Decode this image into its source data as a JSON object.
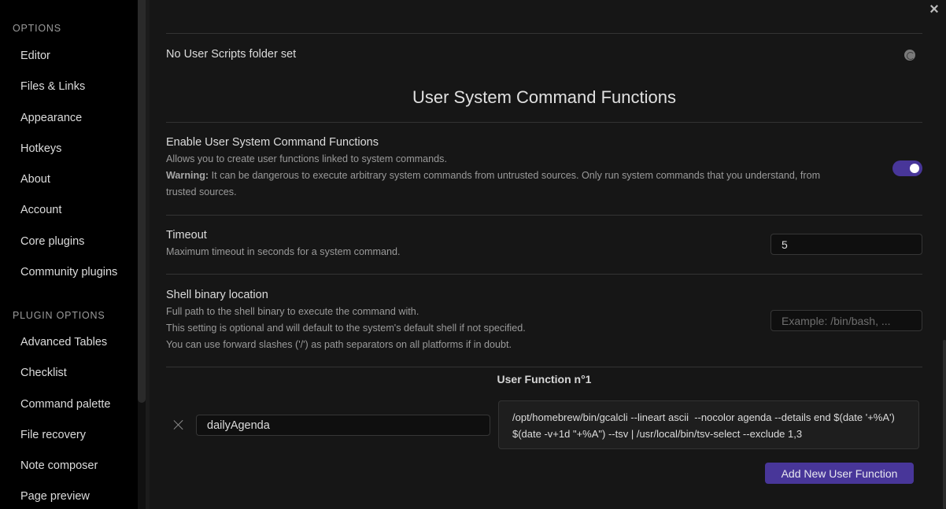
{
  "sidebar": {
    "options_header": "Options",
    "options_items": [
      {
        "label": "Editor"
      },
      {
        "label": "Files & Links"
      },
      {
        "label": "Appearance"
      },
      {
        "label": "Hotkeys"
      },
      {
        "label": "About"
      },
      {
        "label": "Account"
      },
      {
        "label": "Core plugins"
      },
      {
        "label": "Community plugins"
      }
    ],
    "plugin_header": "Plugin Options",
    "plugin_items": [
      {
        "label": "Advanced Tables"
      },
      {
        "label": "Checklist"
      },
      {
        "label": "Command palette"
      },
      {
        "label": "File recovery"
      },
      {
        "label": "Note composer"
      },
      {
        "label": "Page preview"
      }
    ]
  },
  "main": {
    "close_icon": "×",
    "user_scripts": {
      "label": "No User Scripts folder set",
      "icon": "refresh-icon"
    },
    "section_title": "User System Command Functions",
    "enable": {
      "name": "Enable User System Command Functions",
      "desc": "Allows you to create user functions linked to system commands.",
      "warning_label": "Warning:",
      "warning_text": " It can be dangerous to execute arbitrary system commands from untrusted sources. Only run system commands that you understand, from",
      "warning_text2": "trusted sources.",
      "enabled": true
    },
    "timeout": {
      "name": "Timeout",
      "desc": "Maximum timeout in seconds for a system command.",
      "value": "5"
    },
    "shell": {
      "name": "Shell binary location",
      "desc1": "Full path to the shell binary to execute the command with.",
      "desc2": "This setting is optional and will default to the system's default shell if not specified.",
      "desc3": "You can use forward slashes ('/') as path separators on all platforms if in doubt.",
      "value": "",
      "placeholder": "Example: /bin/bash, ..."
    },
    "user_function": {
      "header": "User Function n°1",
      "name": "dailyAgenda",
      "command": "/opt/homebrew/bin/gcalcli --lineart ascii  --nocolor agenda --details end $(date '+%A') $(date -v+1d \"+%A\") --tsv | /usr/local/bin/tsv-select --exclude 1,3"
    },
    "add_button": "Add New User Function"
  },
  "colors": {
    "accent": "#483699",
    "sidebar_bg": "#000000",
    "main_bg": "#161616"
  }
}
